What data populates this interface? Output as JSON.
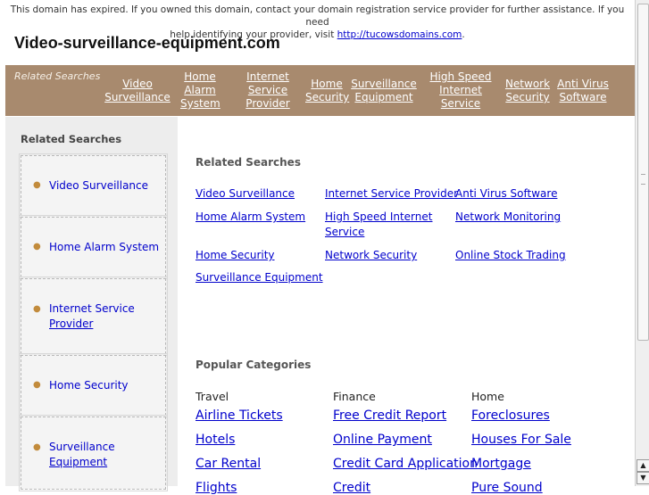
{
  "notice": {
    "line1": "This domain has expired. If you owned this domain, contact your domain registration service provider for further assistance. If you need",
    "line2": "help identifying your provider, visit ",
    "link": "http://tucowsdomains.com",
    "end": "."
  },
  "site_title": "Video-surveillance-equipment.com",
  "topbar": {
    "label": "Related Searches",
    "links": [
      {
        "l1": "Video",
        "l2": "Surveillance",
        "l3": ""
      },
      {
        "l1": "Home",
        "l2": "Alarm",
        "l3": "System"
      },
      {
        "l1": "Internet",
        "l2": "Service",
        "l3": "Provider"
      },
      {
        "l1": "Home",
        "l2": "Security",
        "l3": ""
      },
      {
        "l1": "Surveillance",
        "l2": "Equipment",
        "l3": ""
      },
      {
        "l1": "High Speed",
        "l2": "Internet",
        "l3": "Service"
      },
      {
        "l1": "Network",
        "l2": "Security",
        "l3": ""
      },
      {
        "l1": "Anti Virus",
        "l2": "Software",
        "l3": ""
      }
    ]
  },
  "sidebar": {
    "heading": "Related Searches",
    "items": [
      {
        "l1": "Video Surveillance",
        "l2": ""
      },
      {
        "l1": "Home Alarm System",
        "l2": ""
      },
      {
        "l1": "Internet Service",
        "l2": "Provider"
      },
      {
        "l1": "Home Security",
        "l2": ""
      },
      {
        "l1": "Surveillance",
        "l2": "Equipment"
      }
    ]
  },
  "related": {
    "heading": "Related Searches",
    "links": [
      [
        "Video Surveillance",
        ""
      ],
      [
        "Internet Service Provider",
        ""
      ],
      [
        "Anti Virus Software",
        ""
      ],
      [
        "Home Alarm System",
        ""
      ],
      [
        "High Speed Internet",
        "Service"
      ],
      [
        "Network Monitoring",
        ""
      ],
      [
        "Home Security",
        ""
      ],
      [
        "Network Security",
        ""
      ],
      [
        "Online Stock Trading",
        ""
      ],
      [
        "Surveillance Equipment",
        ""
      ]
    ]
  },
  "popular": {
    "heading": "Popular Categories",
    "columns": [
      {
        "title": "Travel",
        "links": [
          "Airline Tickets",
          "Hotels",
          "Car Rental",
          "Flights"
        ]
      },
      {
        "title": "Finance",
        "links": [
          "Free Credit Report",
          "Online Payment",
          "Credit Card Application",
          "Credit"
        ]
      },
      {
        "title": "Home",
        "links": [
          "Foreclosures",
          "Houses For Sale",
          "Mortgage",
          "Pure Sound"
        ]
      }
    ]
  },
  "icons": {
    "arrow_up": "scroll-up-icon",
    "arrow_down": "scroll-down-icon"
  },
  "colors": {
    "topbar": "#a88a6e",
    "link": "#0000cc",
    "sidebar": "#ededed",
    "bullet": "#c28b3c"
  }
}
